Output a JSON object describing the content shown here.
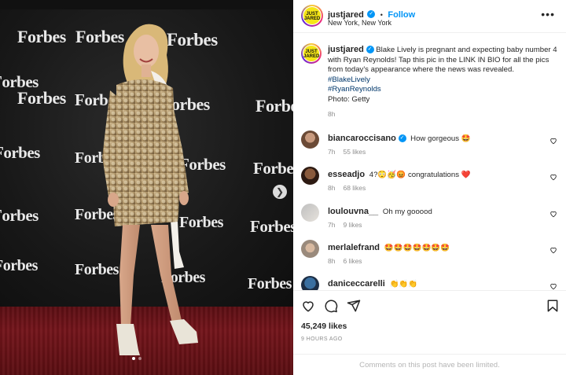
{
  "post": {
    "photo_backdrop_words": [
      "Forbes"
    ],
    "account": {
      "username": "justjared",
      "avatar_text": "JUST JARED",
      "verified_mark": "✓",
      "follow_label": "Follow",
      "separator": "•",
      "location": "New York, New York",
      "more_icon": "more-horizontal-icon"
    },
    "caption": {
      "username": "justjared",
      "text": "Blake Lively is pregnant and expecting baby number 4 with Ryan Reynolds! Tap this pic in the LINK IN BIO for all the pics from today's appearance where the news was revealed.",
      "hashtags": [
        "#BlakeLively",
        "#RyanReynolds"
      ],
      "credit": "Photo: Getty",
      "time": "8h"
    },
    "comments": [
      {
        "username": "biancaroccisano",
        "verified": true,
        "text": "How gorgeous 🤩",
        "time": "7h",
        "likes": "55 likes"
      },
      {
        "username": "esseadjo",
        "verified": false,
        "text": "4?😳🥳😡 congratulations ❤️",
        "time": "8h",
        "likes": "68 likes"
      },
      {
        "username": "loulouvna__",
        "verified": false,
        "text": "Oh my gooood",
        "time": "7h",
        "likes": "9 likes"
      },
      {
        "username": "merlalefrand",
        "verified": false,
        "text": "🤩🤩🤩🤩🤩🤩🤩",
        "time": "8h",
        "likes": "6 likes"
      },
      {
        "username": "daniceccarelli",
        "verified": false,
        "text": "👏👏👏",
        "time": "",
        "likes": ""
      }
    ],
    "actions": {
      "like_icon": "heart-icon",
      "comment_icon": "comment-icon",
      "share_icon": "share-icon",
      "save_icon": "bookmark-icon"
    },
    "likes_count": "45,249 likes",
    "time_ago": "9 HOURS AGO",
    "comments_limited": "Comments on this post have been limited.",
    "carousel": {
      "total": 2,
      "active": 1
    },
    "colors": {
      "link_blue": "#0095f6",
      "hashtag_blue": "#00376b",
      "muted": "#8e8e8e",
      "carpet_red": "#6b1217"
    }
  }
}
